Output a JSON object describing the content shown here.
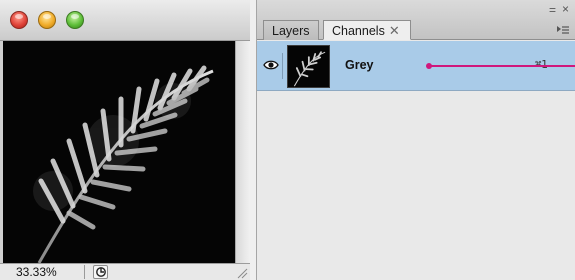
{
  "document_window": {
    "zoom": "33.33%",
    "icons": {
      "close": "close-window-icon",
      "minimize": "minimize-window-icon",
      "maximize": "maximize-window-icon",
      "status_menu": "status-menu-icon",
      "resize": "resize-grip-icon"
    }
  },
  "channels_panel": {
    "tabs": [
      {
        "label": "Layers",
        "active": false
      },
      {
        "label": "Channels",
        "active": true,
        "close_glyph": "✕"
      }
    ],
    "controls": {
      "minimize_glyph": "=",
      "close_glyph": "×"
    },
    "rows": [
      {
        "name": "Grey",
        "shortcut": "⌘1",
        "visible": true,
        "selected": true
      }
    ]
  },
  "colors": {
    "selected_row": "#a9cbe8",
    "callout": "#d0177c"
  }
}
